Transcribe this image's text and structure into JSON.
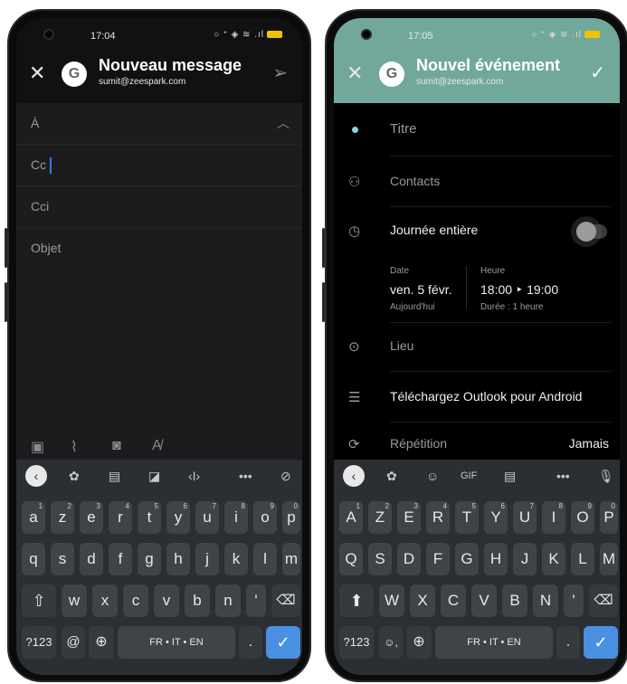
{
  "left": {
    "status": {
      "time": "17:04",
      "icons": "○ ᐩ ◈ ≋ .ıl"
    },
    "header": {
      "title": "Nouveau message",
      "account": "sumit@zeespark.com",
      "avatar_letter": "G"
    },
    "fields": {
      "to": "À",
      "cc": "Cc",
      "bcc": "Cci",
      "subject": "Objet"
    },
    "keyboard": {
      "row1": [
        "a",
        "z",
        "e",
        "r",
        "t",
        "y",
        "u",
        "i",
        "o",
        "p"
      ],
      "row1_hints": [
        "1",
        "2",
        "3",
        "4",
        "5",
        "6",
        "7",
        "8",
        "9",
        "0"
      ],
      "row2": [
        "q",
        "s",
        "d",
        "f",
        "g",
        "h",
        "j",
        "k",
        "l",
        "m"
      ],
      "row3": [
        "w",
        "x",
        "c",
        "v",
        "b",
        "n",
        "'"
      ],
      "bottom": {
        "numbers": "?123",
        "at": "@",
        "space": "FR • IT • EN",
        "period": "."
      }
    }
  },
  "right": {
    "status": {
      "time": "17:05",
      "icons": "○ ᐩ ◈ ≋ .ıl"
    },
    "header": {
      "title": "Nouvel événement",
      "account": "sumit@zeespark.com",
      "avatar_letter": "G"
    },
    "event": {
      "title_placeholder": "Titre",
      "contacts": "Contacts",
      "all_day": "Journée entière",
      "date_label": "Date",
      "date_value": "ven. 5 févr.",
      "date_sub": "Aujourd'hui",
      "time_label": "Heure",
      "time_value": "18:00 ‣ 19:00",
      "duration": "Durée : 1 heure",
      "location": "Lieu",
      "download_outlook": "Téléchargez Outlook pour Android",
      "repeat": "Répétition",
      "repeat_value": "Jamais"
    },
    "keyboard": {
      "gif": "GIF",
      "row1": [
        "A",
        "Z",
        "E",
        "R",
        "T",
        "Y",
        "U",
        "I",
        "O",
        "P"
      ],
      "row1_hints": [
        "1",
        "2",
        "3",
        "4",
        "5",
        "6",
        "7",
        "8",
        "9",
        "0"
      ],
      "row2": [
        "Q",
        "S",
        "D",
        "F",
        "G",
        "H",
        "J",
        "K",
        "L",
        "M"
      ],
      "row3": [
        "W",
        "X",
        "C",
        "V",
        "B",
        "N",
        "'"
      ],
      "bottom": {
        "numbers": "?123",
        "emoji_comma": "☺,",
        "space": "FR • IT • EN",
        "period": "."
      }
    }
  },
  "colors": {
    "accent_blue": "#4a90e2",
    "header_teal": "#72a89c",
    "dark_bg": "#1c1c1e"
  }
}
